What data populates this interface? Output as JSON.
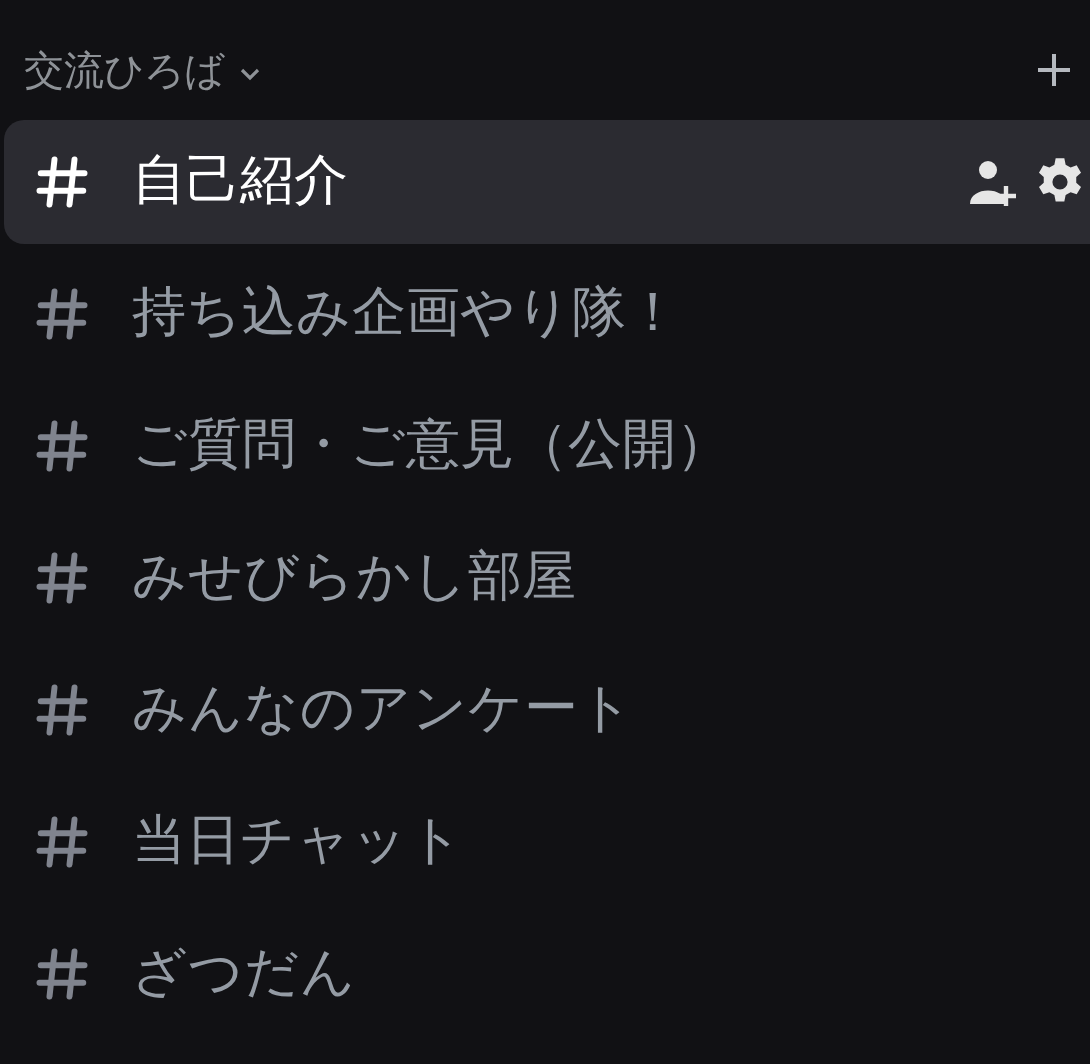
{
  "category": {
    "name": "交流ひろば",
    "expanded": true
  },
  "channels": [
    {
      "name": "自己紹介",
      "selected": true
    },
    {
      "name": "持ち込み企画やり隊！",
      "selected": false
    },
    {
      "name": "ご質問・ご意見（公開）",
      "selected": false
    },
    {
      "name": "みせびらかし部屋",
      "selected": false
    },
    {
      "name": "みんなのアンケート",
      "selected": false
    },
    {
      "name": "当日チャット",
      "selected": false
    },
    {
      "name": "ざつだん",
      "selected": false
    }
  ]
}
